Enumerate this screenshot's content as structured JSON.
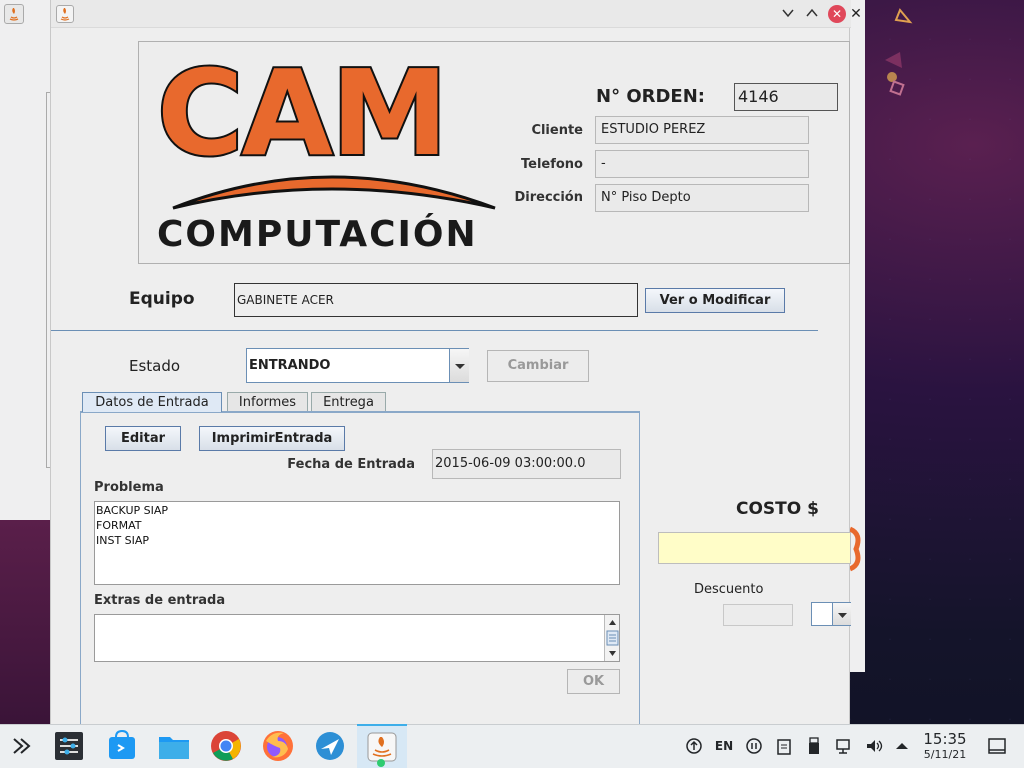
{
  "header": {
    "logo_text": "CAM",
    "logo_subtext": "COMPUTACIÓN",
    "order_label": "N° ORDEN:",
    "order_value": "4146",
    "client_label": "Cliente",
    "client_value": "ESTUDIO PEREZ",
    "phone_label": "Telefono",
    "phone_value": "-",
    "address_label": "Dirección",
    "address_value": "N° Piso Depto"
  },
  "equipment": {
    "label": "Equipo",
    "value": "GABINETE ACER",
    "button": "Ver o Modificar"
  },
  "status": {
    "label": "Estado",
    "selected": "ENTRANDO",
    "change_button": "Cambiar"
  },
  "tabs": [
    {
      "label": "Datos de Entrada",
      "active": true
    },
    {
      "label": "Informes",
      "active": false
    },
    {
      "label": "Entrega",
      "active": false
    }
  ],
  "entry": {
    "edit_button": "Editar",
    "print_button": "ImprimirEntrada",
    "date_label": "Fecha de Entrada",
    "date_value": "2015-06-09 03:00:00.0",
    "problem_label": "Problema",
    "problem_text": "BACKUP SIAP\nFORMAT\nINST SIAP",
    "extras_label": "Extras de entrada",
    "extras_text": "",
    "ok_button": "OK"
  },
  "cost": {
    "label": "COSTO $",
    "value": "",
    "discount_label": "Descuento",
    "discount_value": ""
  },
  "taskbar": {
    "keyboard_layout": "EN",
    "time": "15:35",
    "date": "5/11/21"
  },
  "colors": {
    "logo_orange": "#e8692d",
    "cost_field": "#fffdc8",
    "close_button": "#e0485a",
    "active_task": "#d7e8f5"
  }
}
